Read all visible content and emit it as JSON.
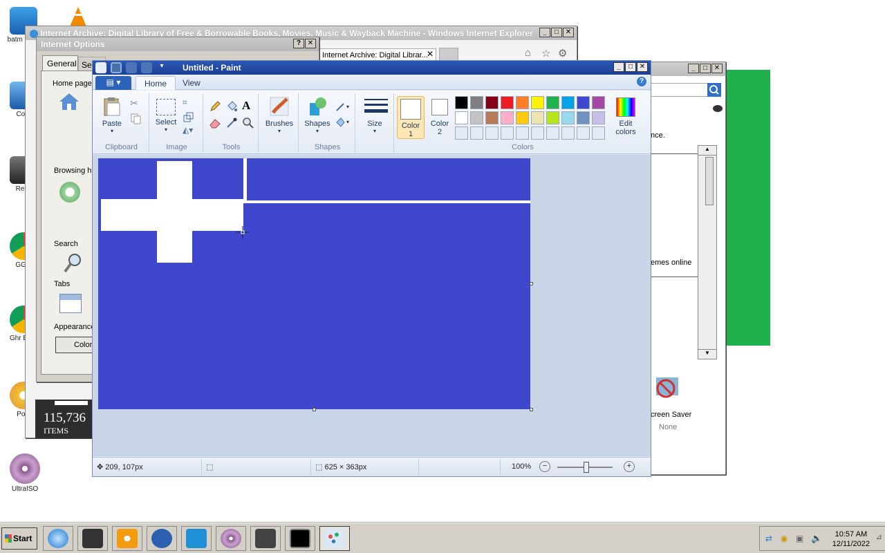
{
  "desktop": {
    "icons": [
      {
        "label": "batm supe"
      },
      {
        "label": "Com"
      },
      {
        "label": "Recy"
      },
      {
        "label": "GGla"
      },
      {
        "label": "Ghr Brov"
      },
      {
        "label": "Pow"
      },
      {
        "label": "UltraISO"
      }
    ]
  },
  "ie_window": {
    "title": "Internet Archive: Digital Library of Free & Borrowable Books, Movies, Music & Wayback Machine - Windows Internet Explorer",
    "tab_label": "Internet Archive: Digital Librar...",
    "stat_number": "115,736",
    "stat_label": "ITEMS"
  },
  "internet_options": {
    "title": "Internet Options",
    "help": "?",
    "tabs": [
      "General",
      "Sec"
    ],
    "home_page_label": "Home page",
    "browsing_label": "Browsing hi",
    "search_label": "Search",
    "tabs_label": "Tabs",
    "appearance_label": "Appearance",
    "colors_button": "Color"
  },
  "background_dialog": {
    "text_fragment_1": "nce.",
    "text_fragment_2": "emes online",
    "screensaver_label": "creen Saver",
    "screensaver_value": "None"
  },
  "paint": {
    "title": "Untitled - Paint",
    "menu_tabs": [
      "Home",
      "View"
    ],
    "help": "?",
    "groups": {
      "clipboard": "Clipboard",
      "image": "Image",
      "tools": "Tools",
      "shapes": "Shapes",
      "colors": "Colors"
    },
    "buttons": {
      "paste": "Paste",
      "select": "Select",
      "brushes": "Brushes",
      "shapes": "Shapes",
      "size": "Size",
      "color1": "Color",
      "color1_num": "1",
      "color2": "Color",
      "color2_num": "2",
      "edit_colors": "Edit colors"
    },
    "palette_row1": [
      "#000000",
      "#7f7f7f",
      "#880015",
      "#ed1c24",
      "#ff7f27",
      "#fff200",
      "#22b14c",
      "#00a2e8",
      "#3f48cc",
      "#a349a4"
    ],
    "palette_row2": [
      "#ffffff",
      "#c3c3c3",
      "#b97a57",
      "#ffaec9",
      "#ffc90e",
      "#efe4b0",
      "#b5e61d",
      "#99d9ea",
      "#7092be",
      "#c8bfe7"
    ],
    "canvas_fill": "#3f48cc",
    "status": {
      "cursor_pos": "209, 107px",
      "image_size": "625 × 363px",
      "zoom": "100%"
    }
  },
  "taskbar": {
    "start": "Start",
    "time": "10:57 AM",
    "date": "12/11/2022"
  }
}
